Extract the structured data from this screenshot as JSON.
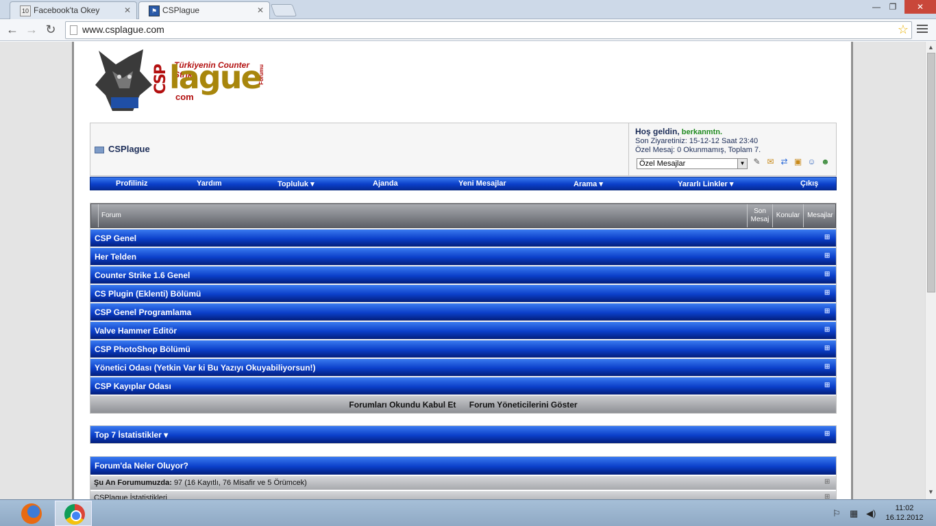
{
  "browser": {
    "tabs": [
      {
        "title": "Facebook'ta Okey",
        "favicon": "10"
      },
      {
        "title": "CSPlague",
        "favicon": "cs-icon"
      }
    ],
    "url": "www.csplague.com",
    "nav": {
      "back": "←",
      "forward": "→",
      "reload": "↻"
    },
    "window_controls": {
      "minimize": "—",
      "maximize": "❐",
      "close": "✕"
    }
  },
  "site": {
    "logo": {
      "brand": "lague",
      "prefix": "CSP",
      "domain": "com",
      "tagline": "Türkiyenin Counter Strike",
      "suffix": "Forumu"
    },
    "title": "CSPlague",
    "welcome": {
      "greeting": "Hoş geldin,",
      "username": "berkanmtn.",
      "last_visit": "Son Ziyaretiniz: 15-12-12 Saat 23:40",
      "pm_status": "Özel Mesaj: 0 Okunmamış, Toplam 7.",
      "pm_select": "Özel Mesajlar"
    },
    "navbar": [
      {
        "label": "Profiliniz",
        "dropdown": false
      },
      {
        "label": "Yardım",
        "dropdown": false
      },
      {
        "label": "Topluluk",
        "dropdown": true
      },
      {
        "label": "Ajanda",
        "dropdown": false
      },
      {
        "label": "Yeni Mesajlar",
        "dropdown": false
      },
      {
        "label": "Arama",
        "dropdown": true
      },
      {
        "label": "Yararlı Linkler",
        "dropdown": true
      },
      {
        "label": "Çıkış",
        "dropdown": false
      }
    ],
    "forum_table": {
      "headers": {
        "forum": "Forum",
        "last_post": "Son Mesaj",
        "topics": "Konular",
        "posts": "Mesajlar"
      },
      "categories": [
        "CSP Genel",
        "Her Telden",
        "Counter Strike 1.6 Genel",
        "CS Plugin (Eklenti) Bölümü",
        "CSP Genel Programlama",
        "Valve Hammer Editör",
        "CSP PhotoShop Bölümü",
        "Yönetici Odası (Yetkin Var ki Bu Yazıyı Okuyabiliyorsun!)",
        "CSP Kayıplar Odası"
      ],
      "actions": [
        "Forumları Okundu Kabul Et",
        "Forum Yöneticilerini Göster"
      ]
    },
    "stats_title": "Top 7 İstatistikler",
    "whats_going_on": {
      "title": "Forum'da Neler Oluyor?",
      "online_label": "Şu An Forumumuzda:",
      "online_value": "97 (16 Kayıtlı, 76 Misafir ve 5 Örümcek)",
      "stats_label": "CSPlague İstatistikleri"
    },
    "colors": {
      "nav_blue": "#0b3fc9",
      "username_green": "#1f8a1f",
      "brand_gold": "#a8860c",
      "brand_red": "#b31010"
    }
  },
  "taskbar": {
    "clock_time": "11:02",
    "clock_date": "16.12.2012",
    "apps": [
      "firefox-icon",
      "chrome-icon"
    ]
  }
}
